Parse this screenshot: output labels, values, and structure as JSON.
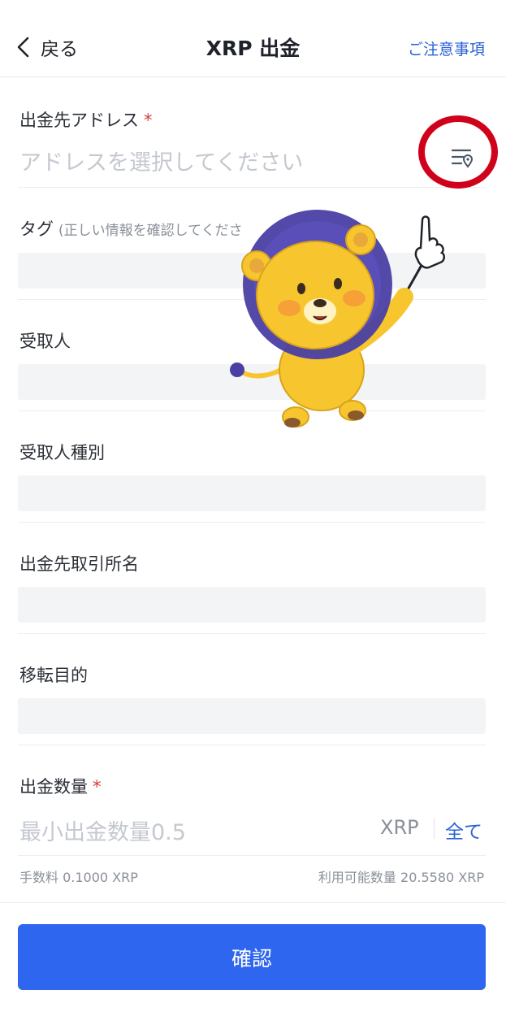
{
  "header": {
    "back_label": "戻る",
    "title": "XRP 出金",
    "notice_label": "ご注意事項"
  },
  "address": {
    "label": "出金先アドレス",
    "required_mark": "*",
    "placeholder": "アドレスを選択してください",
    "icon": "address-book-icon"
  },
  "tag": {
    "label": "タグ",
    "hint": "(正しい情報を確認してくださ"
  },
  "recipient": {
    "label": "受取人"
  },
  "recipient_type": {
    "label": "受取人種別"
  },
  "exchange_name": {
    "label": "出金先取引所名"
  },
  "purpose": {
    "label": "移転目的"
  },
  "amount": {
    "label": "出金数量",
    "required_mark": "*",
    "placeholder": "最小出金数量0.5",
    "unit": "XRP",
    "all_label": "全て"
  },
  "fee_text": "手数料 0.1000 XRP",
  "available_text": "利用可能数量 20.5580 XRP",
  "confirm_label": "確認",
  "colors": {
    "accent": "#2f66ef",
    "link": "#2a61d6",
    "required": "#d63a3a",
    "highlight_circle": "#d0021b",
    "mascot_body": "#f7c62f",
    "mascot_mane": "#4a3fa3"
  }
}
